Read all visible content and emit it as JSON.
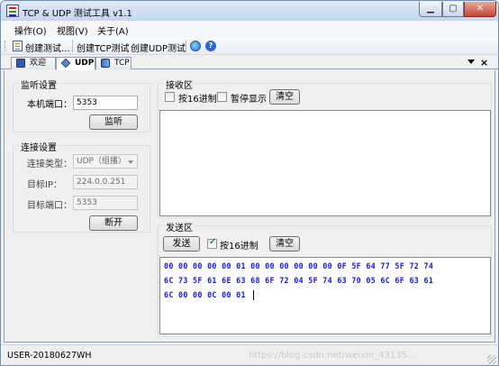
{
  "window": {
    "title": "TCP & UDP 测试工具 v1.1"
  },
  "menu": {
    "items": [
      "操作(O)",
      "视图(V)",
      "关于(A)"
    ]
  },
  "toolbar": {
    "create_test": "创建测试...",
    "create_tcp": "创建TCP测试",
    "create_udp": "创建UDP测试"
  },
  "tabs": [
    {
      "label": "欢迎",
      "icon": "welcome-icon"
    },
    {
      "label": "UDP",
      "icon": "udp-icon"
    },
    {
      "label": "TCP",
      "icon": "tcp-icon"
    }
  ],
  "tab_close_glyph": "×",
  "listen": {
    "group_title": "监听设置",
    "local_port_label": "本机端口：",
    "local_port_value": "5353",
    "listen_button": "监听"
  },
  "connect": {
    "group_title": "连接设置",
    "type_label": "连接类型：",
    "type_value": "UDP（组播）",
    "target_ip_label": "目标IP：",
    "target_ip_value": "224.0.0.251",
    "target_port_label": "目标端口：",
    "target_port_value": "5353",
    "disconnect_button": "断开"
  },
  "receive": {
    "group_title": "接收区",
    "hex_label": "按16进制",
    "hex_checked": false,
    "pause_label": "暂停显示",
    "pause_checked": false,
    "clear_button": "清空"
  },
  "send": {
    "group_title": "发送区",
    "send_button": "发送",
    "hex_label": "按16进制",
    "hex_checked": true,
    "clear_button": "清空",
    "hex_lines": [
      "00 00 00 00 00 01 00 00 00 00 00 00 0F 5F 64 77 5F 72 74",
      "6C 73 5F 61 6E 63 68 6F 72 04 5F 74 63 70 05 6C 6F 63 61",
      "6C 00 00 0C 00 01"
    ]
  },
  "status": {
    "text": "USER-20180627WH",
    "watermark": "https://blog.csdn.net/weixin_43135..."
  }
}
